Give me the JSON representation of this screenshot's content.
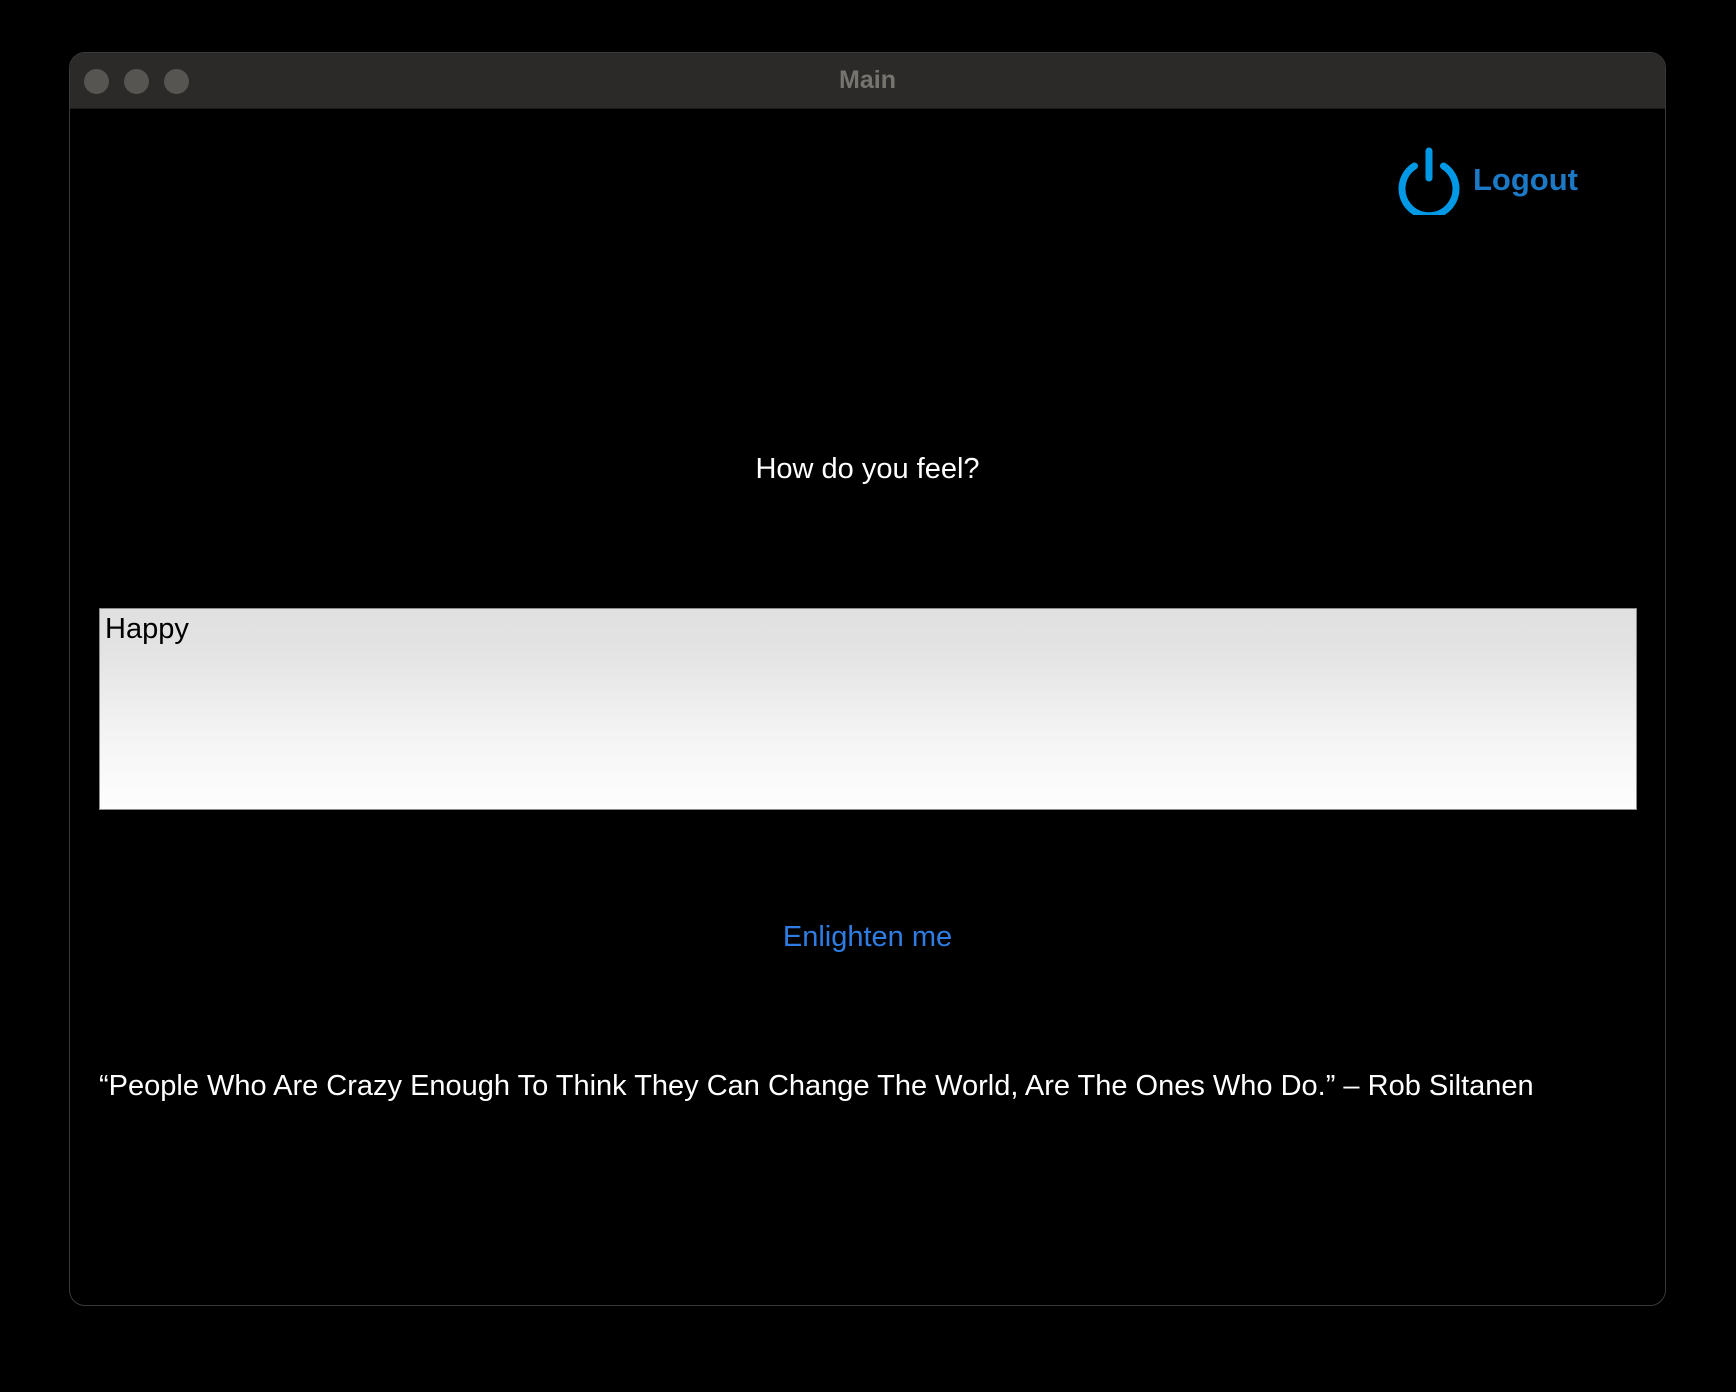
{
  "window": {
    "title": "Main"
  },
  "header": {
    "logout_label": "Logout",
    "logout_icon": "power-icon",
    "accent_color": "#0099e6"
  },
  "main": {
    "prompt": "How do you feel?",
    "mood_value": "Happy",
    "enlighten_label": "Enlighten me",
    "quote": "“People Who Are Crazy Enough To Think They Can Change The World, Are The Ones Who Do.” – Rob Siltanen"
  }
}
